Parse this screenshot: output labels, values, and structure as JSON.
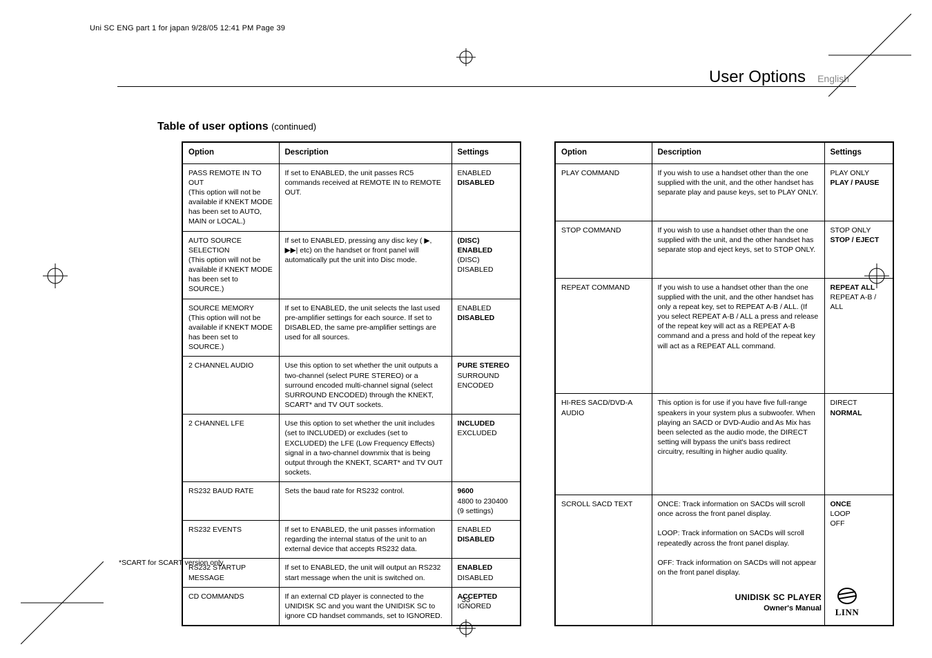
{
  "print_tag": "Uni SC ENG part 1 for japan  9/28/05  12:41 PM  Page 39",
  "header": {
    "title": "User Options",
    "language": "English"
  },
  "section": {
    "title": "Table of user options",
    "continued": "(continued)"
  },
  "table_headers": {
    "option": "Option",
    "description": "Description",
    "settings": "Settings"
  },
  "left_table": [
    {
      "option": "PASS REMOTE IN TO OUT\n(This option will not be available if KNEKT MODE has been set to AUTO, MAIN or LOCAL.)",
      "description": "If set to ENABLED, the unit passes RC5 commands received at REMOTE IN to REMOTE OUT.",
      "settings_html": "ENABLED<br><span class='bold'>DISABLED</span>"
    },
    {
      "option": "AUTO SOURCE SELECTION\n(This option will not be available if KNEKT MODE has been set to SOURCE.)",
      "description": "If set to ENABLED, pressing any disc key ( ▶, ▶▶| etc) on the handset or front panel will automatically put the unit into Disc mode.",
      "settings_html": "<span class='bold'>(DISC) ENABLED</span><br>(DISC) DISABLED"
    },
    {
      "option": "SOURCE MEMORY\n(This option will not be available if KNEKT MODE has been set to SOURCE.)",
      "description": "If set to ENABLED, the unit selects the last used pre-amplifier settings for each source. If set to DISABLED, the same pre-amplifier settings are used for all sources.",
      "settings_html": "ENABLED<br><span class='bold'>DISABLED</span>"
    },
    {
      "option": "2 CHANNEL AUDIO",
      "description": "Use this option to set whether the unit outputs a two-channel (select PURE STEREO) or a surround encoded multi-channel signal (select SURROUND ENCODED) through the KNEKT, SCART* and TV OUT sockets.",
      "settings_html": "<span class='bold'>PURE STEREO</span><br>SURROUND ENCODED"
    },
    {
      "option": "2 CHANNEL LFE",
      "description": "Use this option to set whether the unit includes (set to INCLUDED) or excludes (set to EXCLUDED) the LFE (Low Frequency Effects) signal in a two-channel downmix that is being output through the KNEKT, SCART* and TV OUT sockets.",
      "settings_html": "<span class='bold'>INCLUDED</span><br>EXCLUDED"
    },
    {
      "option": "RS232 BAUD RATE",
      "description": "Sets the baud rate for RS232 control.",
      "settings_html": "<span class='bold'>9600</span><br>4800 to 230400<br>(9 settings)"
    },
    {
      "option": "RS232 EVENTS",
      "description": "If set to ENABLED, the unit passes information regarding the internal status of the unit to an external device that accepts RS232 data.",
      "settings_html": "ENABLED<br><span class='bold'>DISABLED</span>"
    },
    {
      "option": "RS232 STARTUP MESSAGE",
      "description": "If set to ENABLED, the unit will output an RS232 start message when the unit is switched on.",
      "settings_html": "<span class='bold'>ENABLED</span><br>DISABLED"
    },
    {
      "option": "CD COMMANDS",
      "description": "If an external CD player is connected to the UNIDISK SC and you want the UNIDISK SC to ignore CD handset commands, set to IGNORED.",
      "settings_html": "<span class='bold'>ACCEPTED</span><br>IGNORED"
    }
  ],
  "right_table": [
    {
      "option": "PLAY COMMAND",
      "description": "If you wish to use a handset other than the one supplied with the unit, and the other handset has separate play and pause keys, set to PLAY ONLY.",
      "settings_html": "PLAY ONLY<br><span class='bold'>PLAY / PAUSE</span>"
    },
    {
      "option": "STOP COMMAND",
      "description": "If you wish to use a handset other than the one supplied with the unit, and the other handset has separate stop and eject keys, set to STOP ONLY.",
      "settings_html": "STOP ONLY<br><span class='bold'>STOP / EJECT</span>"
    },
    {
      "option": "REPEAT COMMAND",
      "description": "If you wish to use a handset other than the one supplied with the unit, and the other handset has only a repeat key, set to REPEAT A-B / ALL. (If you select REPEAT A-B / ALL a press and release of the repeat key will act as a REPEAT A-B command and a press and hold of the repeat key will act as a REPEAT ALL command.",
      "settings_html": "<span class='bold'>REPEAT ALL</span><br>REPEAT A-B / ALL"
    },
    {
      "option": "HI-RES SACD/DVD-A AUDIO",
      "description": "This option is for use if you have five full-range speakers in your system plus a subwoofer. When playing an SACD or DVD-Audio and As Mix has been selected as the audio mode, the DIRECT setting will bypass the unit's bass redirect circuitry, resulting in higher audio quality.",
      "settings_html": "DIRECT<br><span class='bold'>NORMAL</span>"
    },
    {
      "option": "SCROLL SACD TEXT",
      "description": "ONCE: Track information on SACDs will scroll once across the front panel display.<br><br>LOOP: Track information on SACDs will scroll repeatedly across the front panel display.<br><br>OFF: Track information on SACDs will not appear on the front panel display.",
      "settings_html": "<span class='bold'>ONCE</span><br>LOOP<br>OFF"
    }
  ],
  "footnote": "*SCART for SCART version only.",
  "page_number": "33",
  "footer": {
    "product": "UNIDISK SC PLAYER",
    "subtitle": "Owner's Manual",
    "brand": "LINN"
  }
}
